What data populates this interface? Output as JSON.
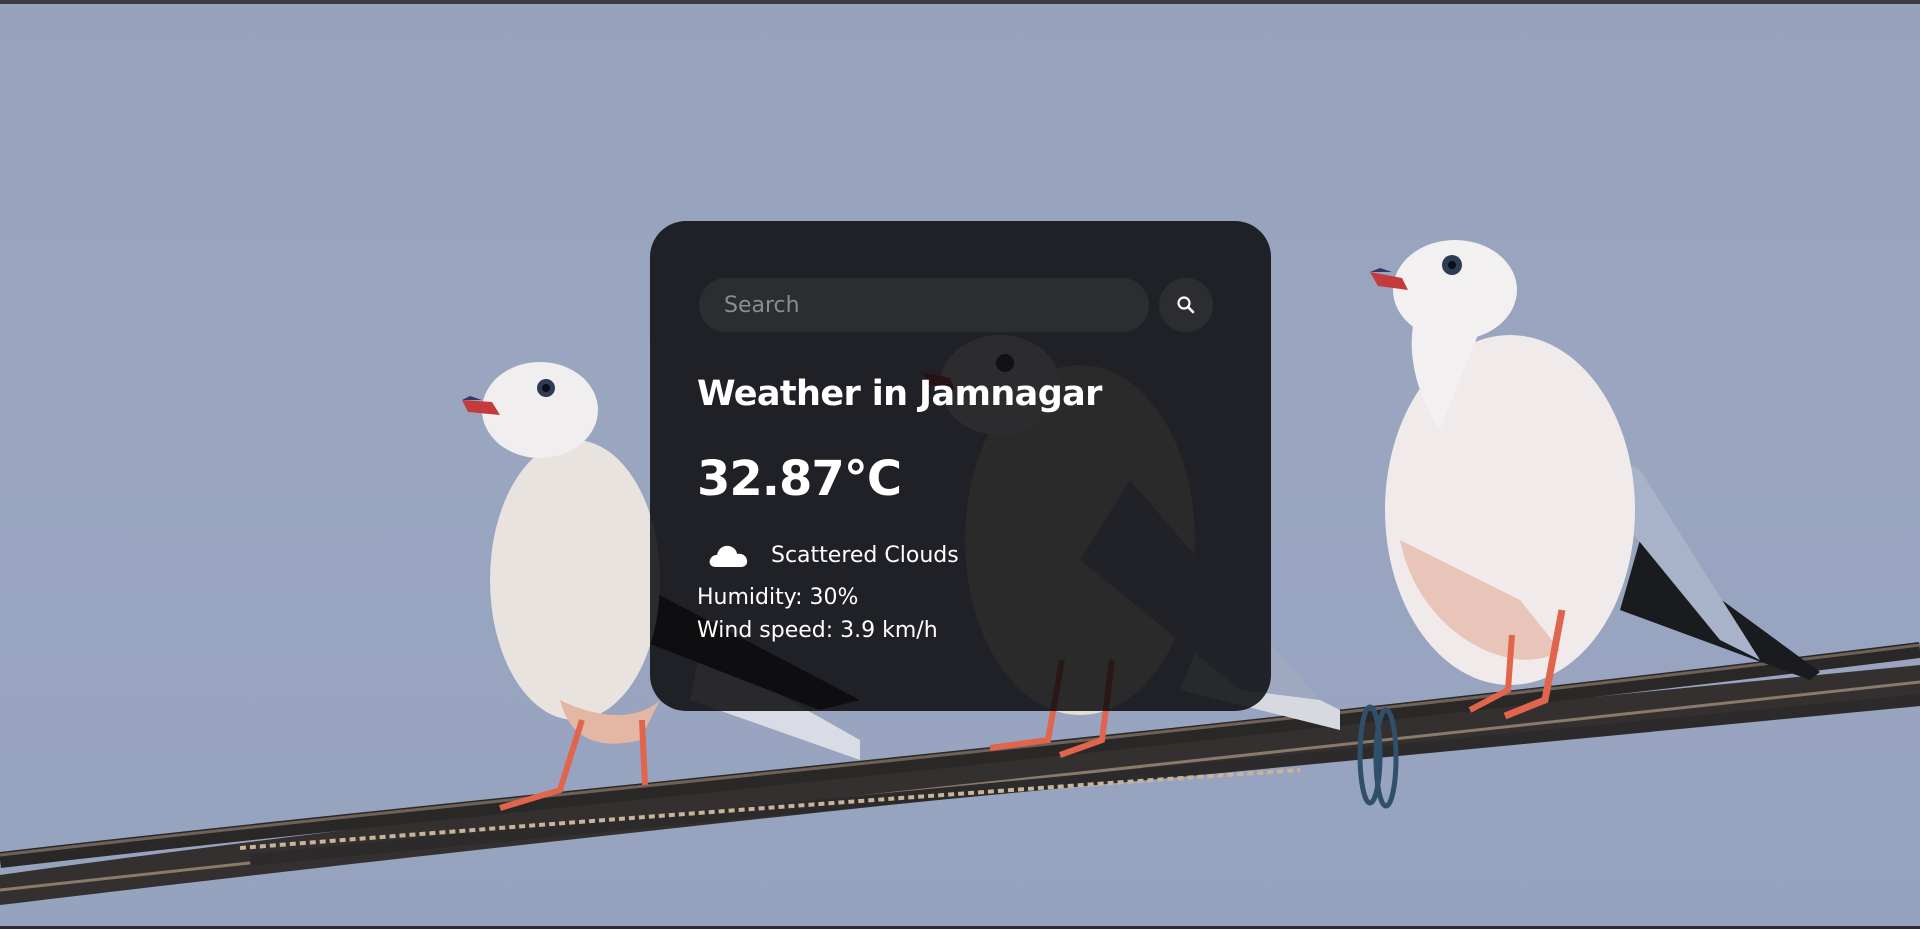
{
  "search": {
    "placeholder": "Search",
    "button_icon": "search-icon"
  },
  "weather": {
    "title": "Weather in Jamnagar",
    "temperature": "32.87°C",
    "icon": "cloud-icon",
    "description": "Scattered Clouds",
    "humidity": "Humidity: 30%",
    "wind": "Wind speed: 3.9 km/h"
  },
  "background": {
    "subject": "background-photo"
  },
  "colors": {
    "sky": "#97a3bd",
    "card": "#0c0c0e",
    "input": "#2c2d31",
    "text": "#ffffff"
  }
}
